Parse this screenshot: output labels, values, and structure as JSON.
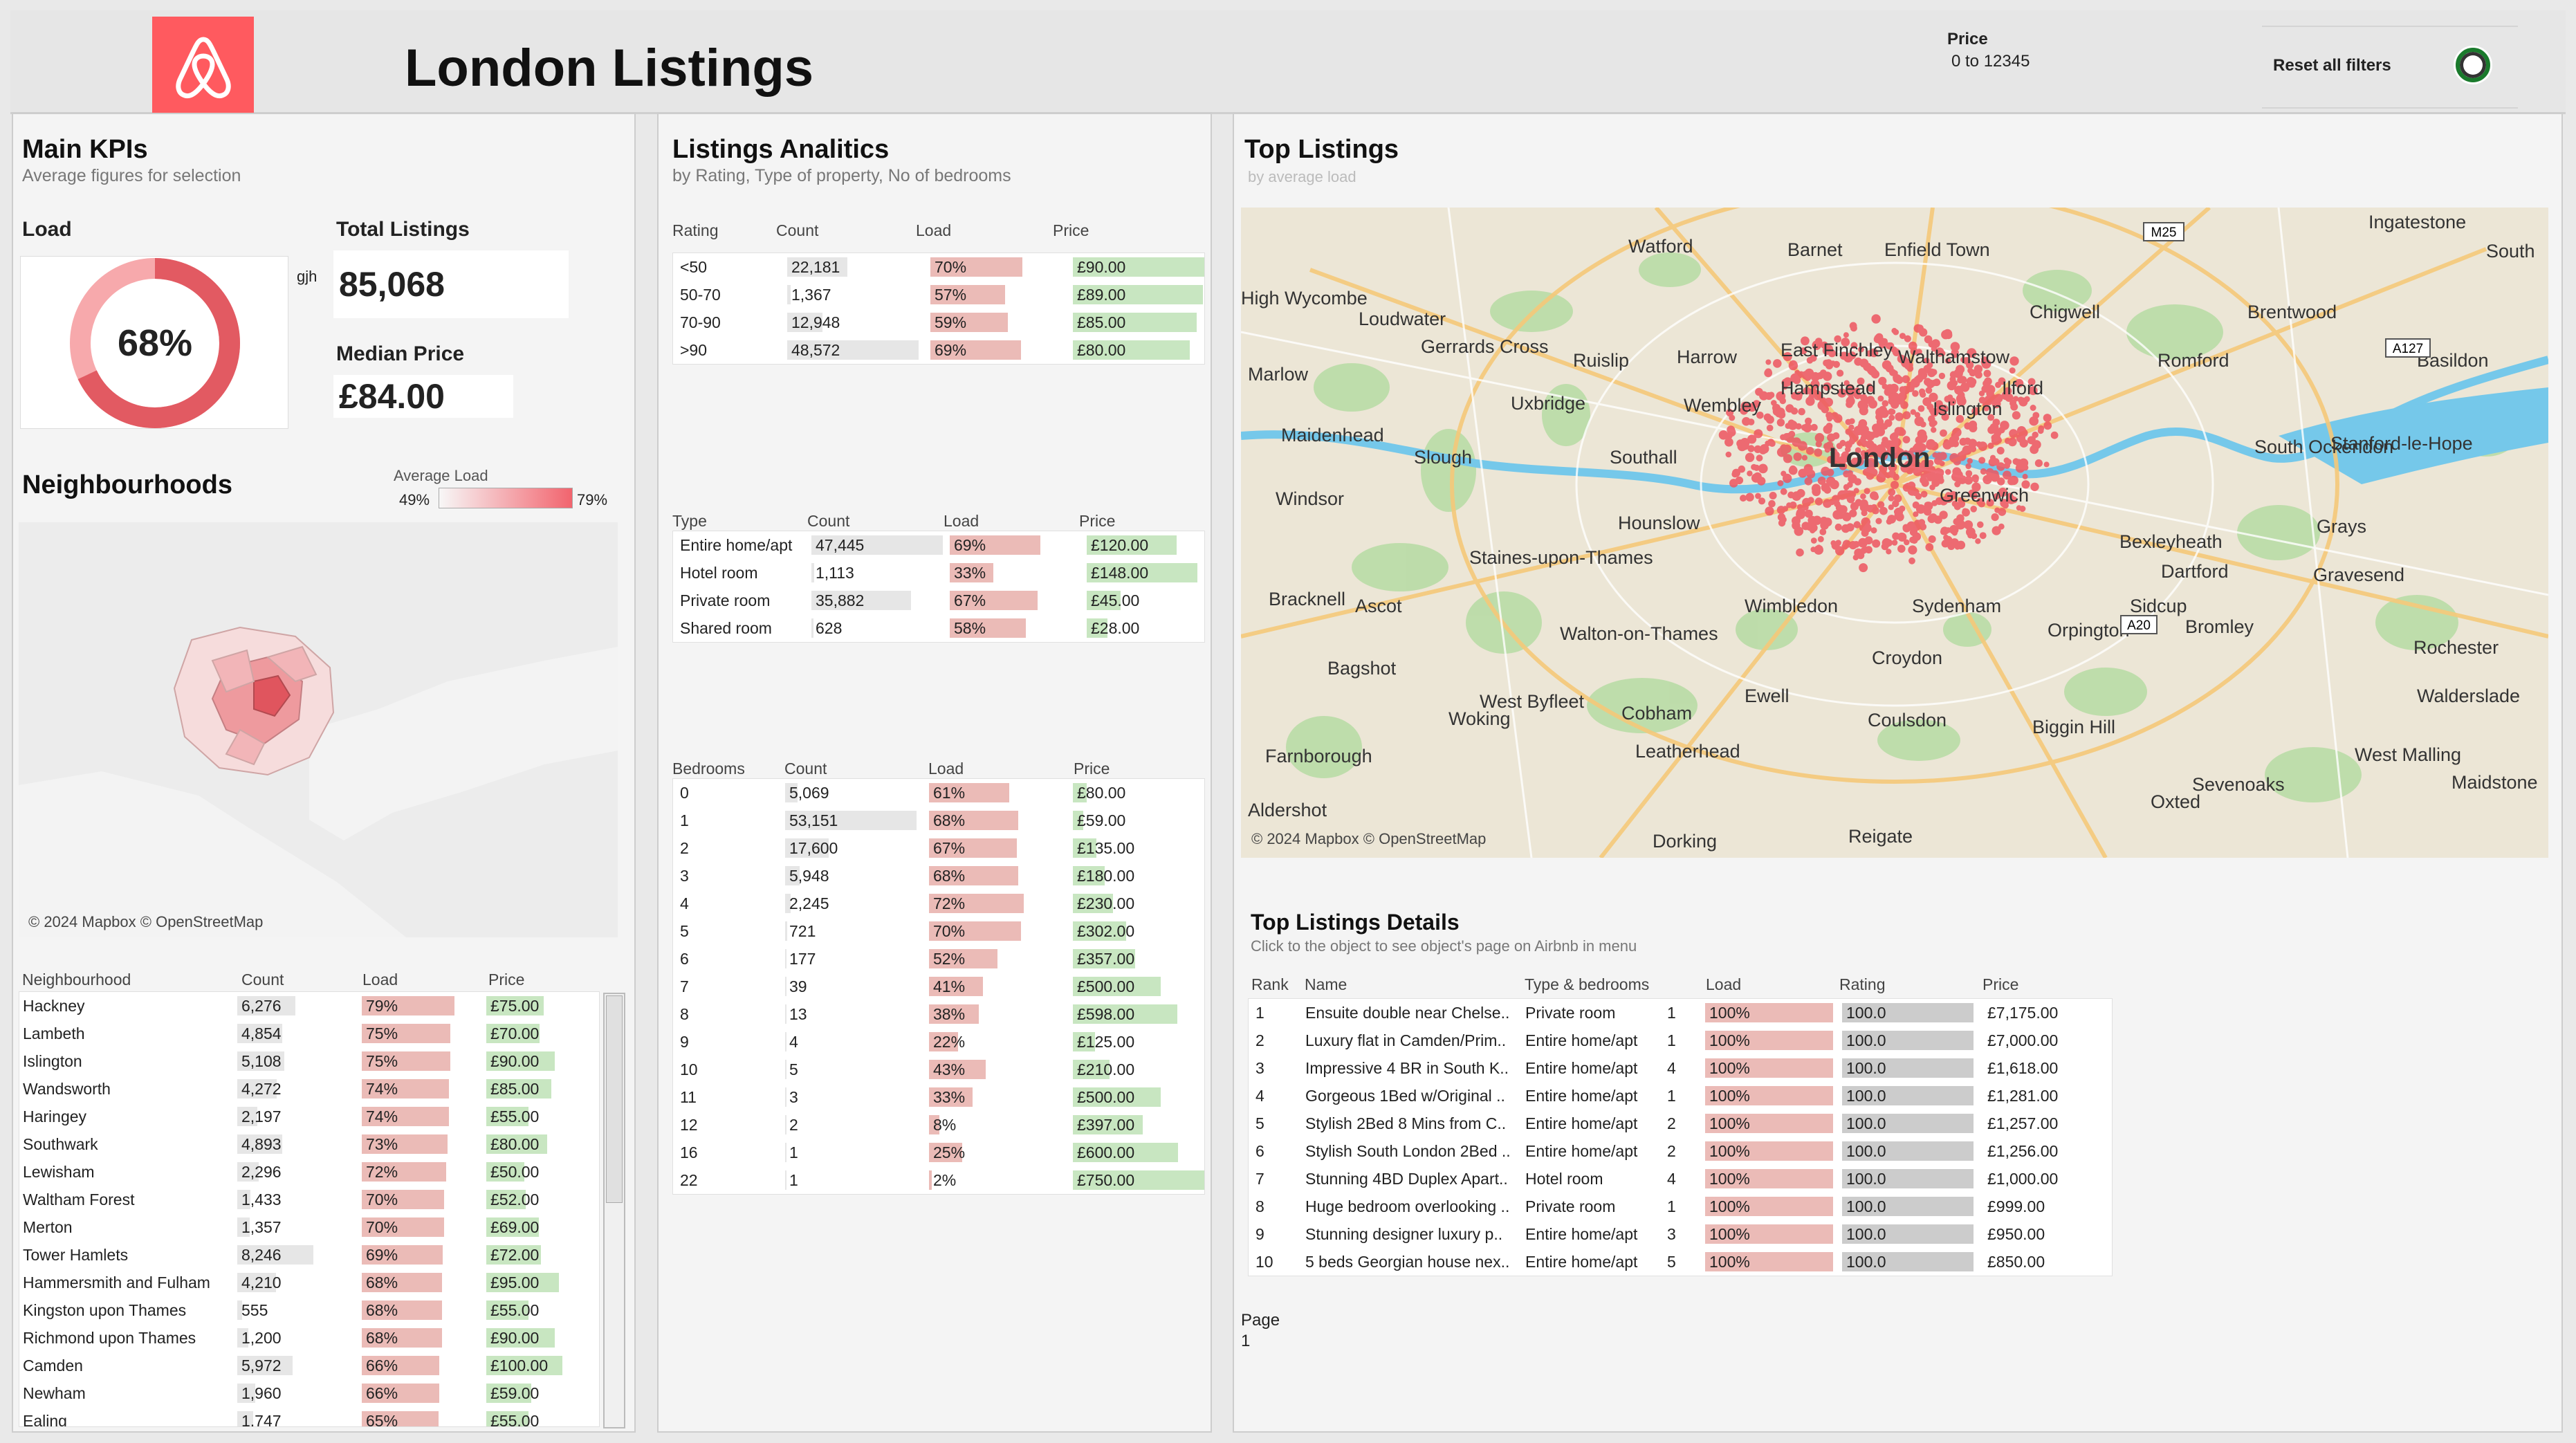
{
  "header": {
    "title": "London Listings",
    "price_filter": {
      "label": "Price",
      "value": "0 to 12345"
    },
    "reset_label": "Reset all filters"
  },
  "kpis": {
    "title": "Main KPIs",
    "subtitle": "Average figures for selection",
    "load_label": "Load",
    "load_value": "68%",
    "load_fraction": 0.68,
    "gjh": "gjh",
    "total_label": "Total Listings",
    "total_value": "85,068",
    "median_label": "Median Price",
    "median_value": "£84.00"
  },
  "neighbourhoods": {
    "title": "Neighbourhoods",
    "legend_title": "Average Load",
    "legend_min": "49%",
    "legend_max": "79%",
    "map_credit": "© 2024 Mapbox © OpenStreetMap",
    "columns": [
      "Neighbourhood",
      "Count",
      "Load",
      "Price"
    ],
    "rows": [
      {
        "name": "Hackney",
        "count": "6,276",
        "count_n": 6276,
        "load": "79%",
        "load_n": 79,
        "price": "£75.00",
        "price_n": 75
      },
      {
        "name": "Lambeth",
        "count": "4,854",
        "count_n": 4854,
        "load": "75%",
        "load_n": 75,
        "price": "£70.00",
        "price_n": 70
      },
      {
        "name": "Islington",
        "count": "5,108",
        "count_n": 5108,
        "load": "75%",
        "load_n": 75,
        "price": "£90.00",
        "price_n": 90
      },
      {
        "name": "Wandsworth",
        "count": "4,272",
        "count_n": 4272,
        "load": "74%",
        "load_n": 74,
        "price": "£85.00",
        "price_n": 85
      },
      {
        "name": "Haringey",
        "count": "2,197",
        "count_n": 2197,
        "load": "74%",
        "load_n": 74,
        "price": "£55.00",
        "price_n": 55
      },
      {
        "name": "Southwark",
        "count": "4,893",
        "count_n": 4893,
        "load": "73%",
        "load_n": 73,
        "price": "£80.00",
        "price_n": 80
      },
      {
        "name": "Lewisham",
        "count": "2,296",
        "count_n": 2296,
        "load": "72%",
        "load_n": 72,
        "price": "£50.00",
        "price_n": 50
      },
      {
        "name": "Waltham Forest",
        "count": "1,433",
        "count_n": 1433,
        "load": "70%",
        "load_n": 70,
        "price": "£52.00",
        "price_n": 52
      },
      {
        "name": "Merton",
        "count": "1,357",
        "count_n": 1357,
        "load": "70%",
        "load_n": 70,
        "price": "£69.00",
        "price_n": 69
      },
      {
        "name": "Tower Hamlets",
        "count": "8,246",
        "count_n": 8246,
        "load": "69%",
        "load_n": 69,
        "price": "£72.00",
        "price_n": 72
      },
      {
        "name": "Hammersmith and Fulham",
        "count": "4,210",
        "count_n": 4210,
        "load": "68%",
        "load_n": 68,
        "price": "£95.00",
        "price_n": 95
      },
      {
        "name": "Kingston upon Thames",
        "count": "555",
        "count_n": 555,
        "load": "68%",
        "load_n": 68,
        "price": "£55.00",
        "price_n": 55
      },
      {
        "name": "Richmond upon Thames",
        "count": "1,200",
        "count_n": 1200,
        "load": "68%",
        "load_n": 68,
        "price": "£90.00",
        "price_n": 90
      },
      {
        "name": "Camden",
        "count": "5,972",
        "count_n": 5972,
        "load": "66%",
        "load_n": 66,
        "price": "£100.00",
        "price_n": 100
      },
      {
        "name": "Newham",
        "count": "1,960",
        "count_n": 1960,
        "load": "66%",
        "load_n": 66,
        "price": "£59.00",
        "price_n": 59
      },
      {
        "name": "Ealing",
        "count": "1,747",
        "count_n": 1747,
        "load": "65%",
        "load_n": 65,
        "price": "£55.00",
        "price_n": 55
      }
    ]
  },
  "analytics": {
    "title": "Listings Analitics",
    "subtitle": "by Rating, Type of property, No of bedrooms",
    "rating": {
      "columns": [
        "Rating",
        "Count",
        "Load",
        "Price"
      ],
      "rows": [
        {
          "name": "<50",
          "count": "22,181",
          "count_n": 22181,
          "load": "70%",
          "load_n": 70,
          "price": "£90.00",
          "price_n": 90
        },
        {
          "name": "50-70",
          "count": "1,367",
          "count_n": 1367,
          "load": "57%",
          "load_n": 57,
          "price": "£89.00",
          "price_n": 89
        },
        {
          "name": "70-90",
          "count": "12,948",
          "count_n": 12948,
          "load": "59%",
          "load_n": 59,
          "price": "£85.00",
          "price_n": 85
        },
        {
          "name": ">90",
          "count": "48,572",
          "count_n": 48572,
          "load": "69%",
          "load_n": 69,
          "price": "£80.00",
          "price_n": 80
        }
      ]
    },
    "type": {
      "columns": [
        "Type",
        "Count",
        "Load",
        "Price"
      ],
      "rows": [
        {
          "name": "Entire home/apt",
          "count": "47,445",
          "count_n": 47445,
          "load": "69%",
          "load_n": 69,
          "price": "£120.00",
          "price_n": 120
        },
        {
          "name": "Hotel room",
          "count": "1,113",
          "count_n": 1113,
          "load": "33%",
          "load_n": 33,
          "price": "£148.00",
          "price_n": 148
        },
        {
          "name": "Private room",
          "count": "35,882",
          "count_n": 35882,
          "load": "67%",
          "load_n": 67,
          "price": "£45.00",
          "price_n": 45
        },
        {
          "name": "Shared room",
          "count": "628",
          "count_n": 628,
          "load": "58%",
          "load_n": 58,
          "price": "£28.00",
          "price_n": 28
        }
      ]
    },
    "bedrooms": {
      "columns": [
        "Bedrooms",
        "Count",
        "Load",
        "Price"
      ],
      "rows": [
        {
          "name": "0",
          "count": "5,069",
          "count_n": 5069,
          "load": "61%",
          "load_n": 61,
          "price": "£80.00",
          "price_n": 80
        },
        {
          "name": "1",
          "count": "53,151",
          "count_n": 53151,
          "load": "68%",
          "load_n": 68,
          "price": "£59.00",
          "price_n": 59
        },
        {
          "name": "2",
          "count": "17,600",
          "count_n": 17600,
          "load": "67%",
          "load_n": 67,
          "price": "£135.00",
          "price_n": 135
        },
        {
          "name": "3",
          "count": "5,948",
          "count_n": 5948,
          "load": "68%",
          "load_n": 68,
          "price": "£180.00",
          "price_n": 180
        },
        {
          "name": "4",
          "count": "2,245",
          "count_n": 2245,
          "load": "72%",
          "load_n": 72,
          "price": "£230.00",
          "price_n": 230
        },
        {
          "name": "5",
          "count": "721",
          "count_n": 721,
          "load": "70%",
          "load_n": 70,
          "price": "£302.00",
          "price_n": 302
        },
        {
          "name": "6",
          "count": "177",
          "count_n": 177,
          "load": "52%",
          "load_n": 52,
          "price": "£357.00",
          "price_n": 357
        },
        {
          "name": "7",
          "count": "39",
          "count_n": 39,
          "load": "41%",
          "load_n": 41,
          "price": "£500.00",
          "price_n": 500
        },
        {
          "name": "8",
          "count": "13",
          "count_n": 13,
          "load": "38%",
          "load_n": 38,
          "price": "£598.00",
          "price_n": 598
        },
        {
          "name": "9",
          "count": "4",
          "count_n": 4,
          "load": "22%",
          "load_n": 22,
          "price": "£125.00",
          "price_n": 125
        },
        {
          "name": "10",
          "count": "5",
          "count_n": 5,
          "load": "43%",
          "load_n": 43,
          "price": "£210.00",
          "price_n": 210
        },
        {
          "name": "11",
          "count": "3",
          "count_n": 3,
          "load": "33%",
          "load_n": 33,
          "price": "£500.00",
          "price_n": 500
        },
        {
          "name": "12",
          "count": "2",
          "count_n": 2,
          "load": "8%",
          "load_n": 8,
          "price": "£397.00",
          "price_n": 397
        },
        {
          "name": "16",
          "count": "1",
          "count_n": 1,
          "load": "25%",
          "load_n": 25,
          "price": "£600.00",
          "price_n": 600
        },
        {
          "name": "22",
          "count": "1",
          "count_n": 1,
          "load": "2%",
          "load_n": 2,
          "price": "£750.00",
          "price_n": 750
        }
      ]
    }
  },
  "top_listings": {
    "title": "Top Listings",
    "subtitle": "by average load",
    "map_credit": "© 2024 Mapbox © OpenStreetMap",
    "map_places": [
      "Watford",
      "Barnet",
      "Enfield Town",
      "South",
      "High Wycombe",
      "Loudwater",
      "Chigwell",
      "Brentwood",
      "Gerrards Cross",
      "Ruislip",
      "Harrow",
      "East Finchley",
      "Walthamstow",
      "Romford",
      "Basildon",
      "Marlow",
      "Hampstead",
      "Ilford",
      "Uxbridge",
      "Wembley",
      "Islington",
      "Maidenhead",
      "Slough",
      "Southall",
      "London",
      "South Ockendon",
      "Stanford-le-Hope",
      "Windsor",
      "Hounslow",
      "Greenwich",
      "Grays",
      "Bexleyheath",
      "Staines-upon-Thames",
      "Dartford",
      "Gravesend",
      "Bracknell",
      "Ascot",
      "Wimbledon",
      "Sydenham",
      "Sidcup",
      "Bromley",
      "Walton-on-Thames",
      "Orpington",
      "Rochester",
      "Bagshot",
      "Croydon",
      "Ewell",
      "West Byfleet",
      "Cobham",
      "Woking",
      "Coulsdon",
      "Biggin Hill",
      "Walderslade",
      "Leatherhead",
      "West Malling",
      "Farnborough",
      "Sevenoaks",
      "Maidstone",
      "Oxted",
      "Aldershot",
      "Dorking",
      "Reigate",
      "Ingatestone"
    ],
    "road_labels": [
      "M25",
      "A127",
      "A20"
    ]
  },
  "details": {
    "title": "Top Listings Details",
    "subtitle": "Click to the object to see object's page on Airbnb in menu",
    "columns": [
      "Rank",
      "Name",
      "Type & bedrooms",
      "Load",
      "Rating",
      "Price"
    ],
    "rows": [
      {
        "rank": "1",
        "name": "Ensuite double near Chelse..",
        "type": "Private room",
        "beds": "1",
        "load": "100%",
        "rating": "100.0",
        "price": "£7,175.00"
      },
      {
        "rank": "2",
        "name": "Luxury flat in Camden/Prim..",
        "type": "Entire home/apt",
        "beds": "1",
        "load": "100%",
        "rating": "100.0",
        "price": "£7,000.00"
      },
      {
        "rank": "3",
        "name": "Impressive 4 BR in South K..",
        "type": "Entire home/apt",
        "beds": "4",
        "load": "100%",
        "rating": "100.0",
        "price": "£1,618.00"
      },
      {
        "rank": "4",
        "name": "Gorgeous 1Bed w/Original ..",
        "type": "Entire home/apt",
        "beds": "1",
        "load": "100%",
        "rating": "100.0",
        "price": "£1,281.00"
      },
      {
        "rank": "5",
        "name": "Stylish 2Bed 8 Mins from C..",
        "type": "Entire home/apt",
        "beds": "2",
        "load": "100%",
        "rating": "100.0",
        "price": "£1,257.00"
      },
      {
        "rank": "6",
        "name": "Stylish South London 2Bed ..",
        "type": "Entire home/apt",
        "beds": "2",
        "load": "100%",
        "rating": "100.0",
        "price": "£1,256.00"
      },
      {
        "rank": "7",
        "name": "Stunning 4BD Duplex Apart..",
        "type": "Hotel room",
        "beds": "4",
        "load": "100%",
        "rating": "100.0",
        "price": "£1,000.00"
      },
      {
        "rank": "8",
        "name": "Huge bedroom overlooking ..",
        "type": "Private room",
        "beds": "1",
        "load": "100%",
        "rating": "100.0",
        "price": "£999.00"
      },
      {
        "rank": "9",
        "name": "Stunning designer luxury p..",
        "type": "Entire home/apt",
        "beds": "3",
        "load": "100%",
        "rating": "100.0",
        "price": "£950.00"
      },
      {
        "rank": "10",
        "name": "5 beds Georgian house nex..",
        "type": "Entire home/apt",
        "beds": "5",
        "load": "100%",
        "rating": "100.0",
        "price": "£850.00"
      }
    ],
    "page_label": "Page",
    "page_value": "1"
  },
  "colors": {
    "brand": "#ff5a5f",
    "load_bar": "#ebbbb7",
    "price_bar": "#c8e6c1",
    "count_bar": "#e6e6e6",
    "donut_fill": "#e25a62",
    "donut_rest": "#f7a9ac",
    "map_dot": "#ee5560"
  }
}
